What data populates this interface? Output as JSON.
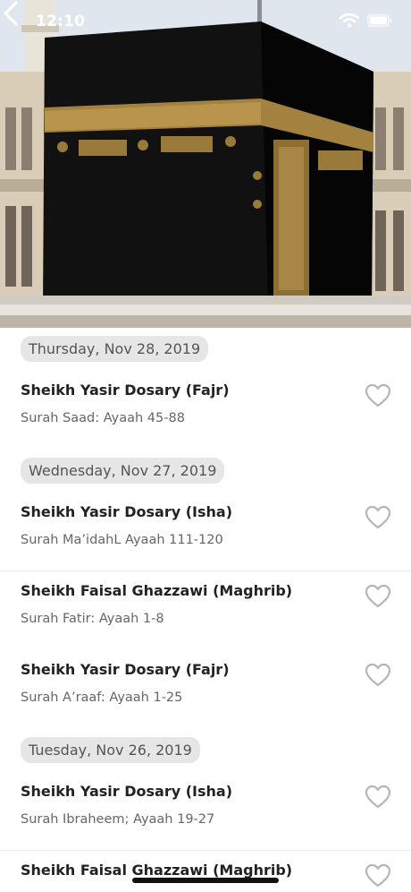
{
  "status": {
    "time": "12:10"
  },
  "sections": [
    {
      "date": "Thursday, Nov 28, 2019",
      "items": [
        {
          "title": "Sheikh Yasir Dosary (Fajr)",
          "subtitle": "Surah Saad: Ayaah 45-88"
        }
      ]
    },
    {
      "date": "Wednesday, Nov 27, 2019",
      "items": [
        {
          "title": "Sheikh Yasir Dosary (Isha)",
          "subtitle": "Surah Ma’idahL Ayaah 111-120"
        },
        {
          "title": "Sheikh Faisal Ghazzawi (Maghrib)",
          "subtitle": "Surah Fatir: Ayaah 1-8"
        },
        {
          "title": "Sheikh Yasir Dosary (Fajr)",
          "subtitle": "Surah A’raaf: Ayaah 1-25"
        }
      ]
    },
    {
      "date": "Tuesday, Nov 26, 2019",
      "items": [
        {
          "title": "Sheikh Yasir Dosary (Isha)",
          "subtitle": "Surah Ibraheem; Ayaah 19-27"
        },
        {
          "title": "Sheikh Faisal Ghazzawi (Maghrib)",
          "subtitle": ""
        }
      ]
    }
  ]
}
